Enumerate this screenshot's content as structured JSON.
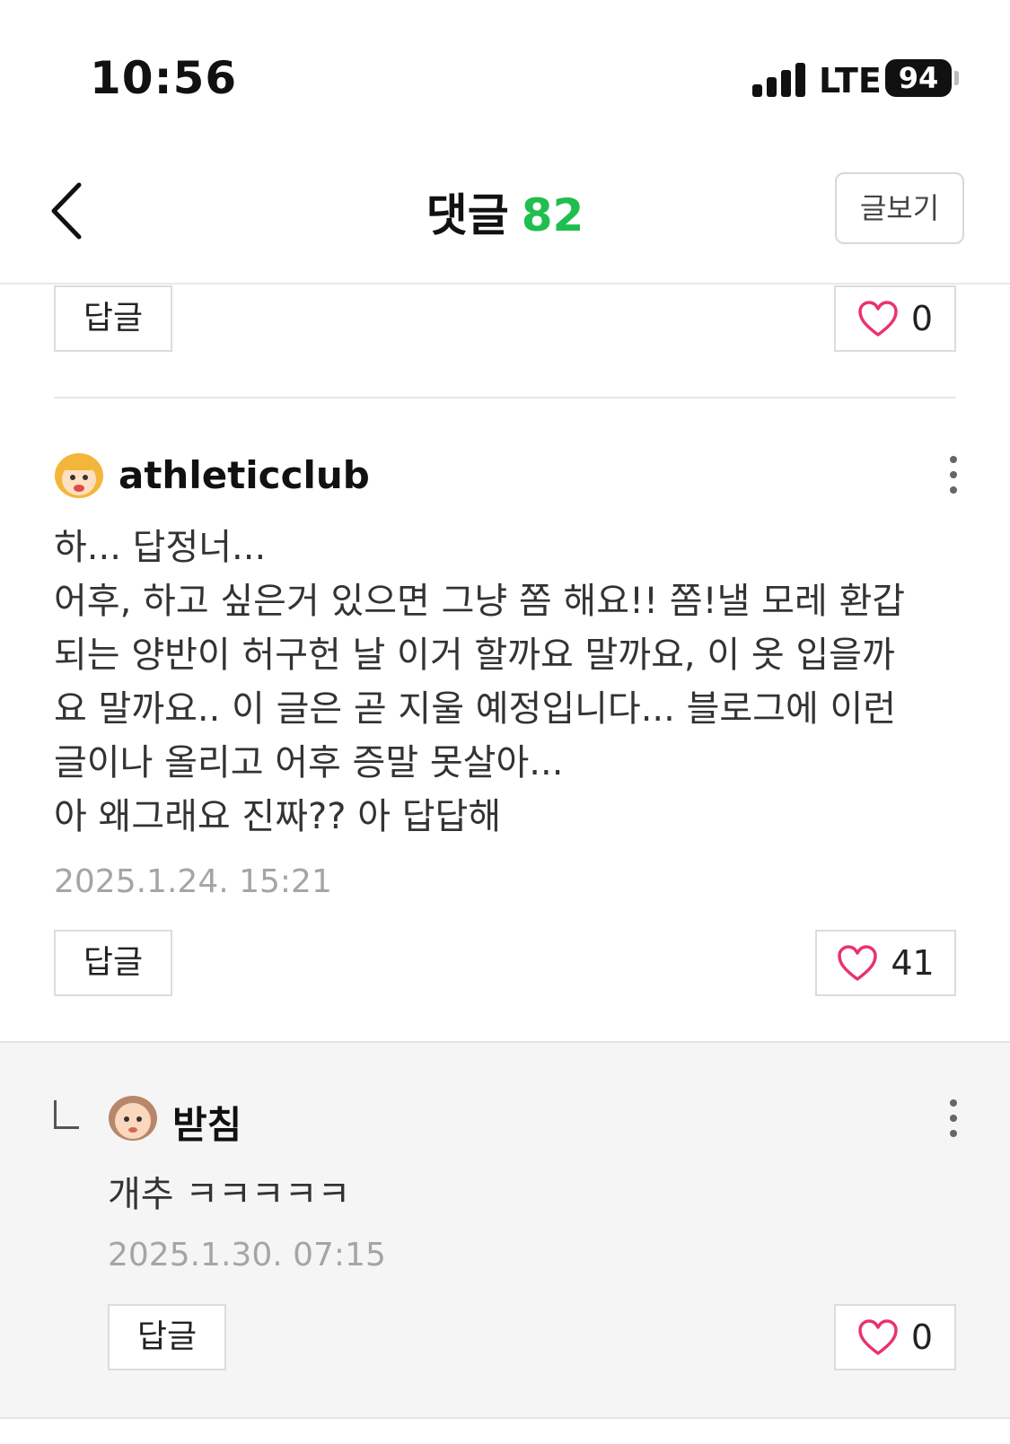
{
  "status_bar": {
    "time": "10:56",
    "network": "LTE",
    "battery": "94"
  },
  "header": {
    "title": "댓글",
    "count": "82",
    "view_post": "글보기"
  },
  "prev_comment": {
    "reply_label": "답글",
    "likes": "0"
  },
  "comment": {
    "username": "athleticclub",
    "text": "하... 답정너...\n어후, 하고 싶은거 있으면 그냥 쫌 해요!! 쫌!낼 모레 환갑\n되는 양반이 허구헌 날 이거 할까요 말까요, 이 옷 입을까\n요 말까요.. 이 글은 곧 지울 예정입니다... 블로그에 이런\n글이나 올리고 어후 증말 못살아...\n아 왜그래요 진짜?? 아 답답해",
    "date": "2025.1.24. 15:21",
    "reply_label": "답글",
    "likes": "41"
  },
  "reply": {
    "username": "받침",
    "text": "개추 ㅋㅋㅋㅋㅋ",
    "date": "2025.1.30. 07:15",
    "reply_label": "답글",
    "likes": "0"
  },
  "colors": {
    "accent_green": "#1fbe4e",
    "heart_pink": "#e8336f"
  }
}
